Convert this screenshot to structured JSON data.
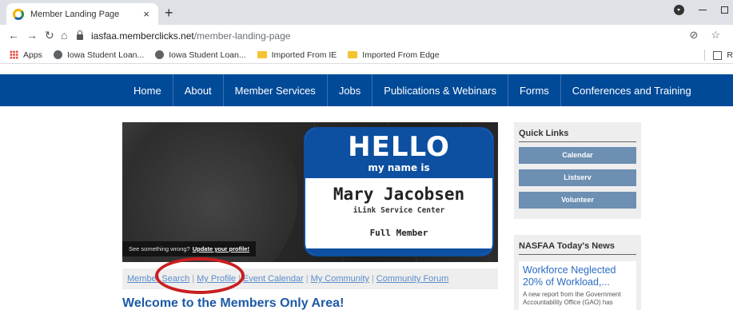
{
  "browser": {
    "tab_title": "Member Landing Page",
    "tab_close": "×",
    "new_tab": "+",
    "url_host": "iasfaa.memberclicks.net",
    "url_path": "/member-landing-page",
    "bookmarks": [
      {
        "label": "Apps",
        "icon": "apps-grid-icon"
      },
      {
        "label": "Iowa Student Loan...",
        "icon": "globe-icon"
      },
      {
        "label": "Iowa Student Loan...",
        "icon": "globe-icon"
      },
      {
        "label": "Imported From IE",
        "icon": "folder-icon"
      },
      {
        "label": "Imported From Edge",
        "icon": "folder-icon"
      }
    ],
    "reading_list_label": "R"
  },
  "nav": {
    "items": [
      "Home",
      "About",
      "Member Services",
      "Jobs",
      "Publications & Webinars",
      "Forms",
      "Conferences and Training"
    ],
    "color": "#004a98"
  },
  "hero": {
    "hello": "HELLO",
    "my_name_is": "my name is",
    "name": "Mary Jacobsen",
    "center": "iLink Service Center",
    "member_type": "Full Member",
    "note_text": "See something wrong?",
    "note_link": "Update your profile!"
  },
  "member_links": [
    "Member Search",
    "My Profile",
    "Event Calendar",
    "My Community",
    "Community Forum"
  ],
  "welcome": "Welcome to the Members Only Area!",
  "quick_links": {
    "title": "Quick Links",
    "buttons": [
      "Calendar",
      "Listserv",
      "Volunteer"
    ]
  },
  "news": {
    "title": "NASFAA Today's News",
    "headline": "Workforce Neglected 20% of Workload,...",
    "excerpt": "A new report from the Government Accountability Office (GAO) has"
  },
  "colors": {
    "accent": "#1c5aa6",
    "annotation": "#c91f1f"
  }
}
